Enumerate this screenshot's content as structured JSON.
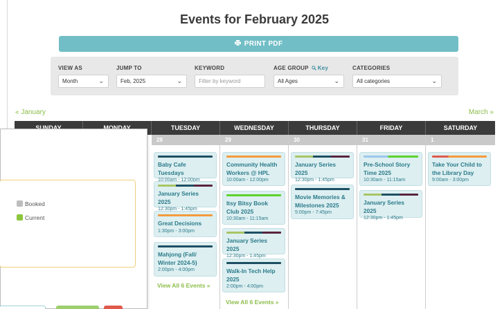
{
  "page": {
    "title": "Events for February 2025"
  },
  "print_button": {
    "label": "PRINT PDF",
    "icon": "printer-icon"
  },
  "filters": {
    "view_as": {
      "label": "VIEW AS",
      "value": "Month"
    },
    "jump_to": {
      "label": "JUMP TO",
      "value": "Feb, 2025"
    },
    "keyword": {
      "label": "KEYWORD",
      "placeholder": "Filter by keyword"
    },
    "age_group": {
      "label": "AGE GROUP",
      "key_label": "Key",
      "value": "All Ages"
    },
    "categories": {
      "label": "CATEGORIES",
      "value": "All categories"
    }
  },
  "nav": {
    "prev": "« January",
    "next": "March »"
  },
  "weekdays": [
    "SUNDAY",
    "MONDAY",
    "TUESDAY",
    "WEDNESDAY",
    "THURSDAY",
    "FRIDAY",
    "SATURDAY"
  ],
  "days": {
    "tuesday": {
      "date": "28",
      "events": [
        {
          "title": "Baby Cafe Tuesdays",
          "time": "10:00am - 12:00pm"
        },
        {
          "title": "January Series 2025",
          "time": "12:30pm - 1:45pm"
        },
        {
          "title": "Great Decisions",
          "time": "1:30pm - 3:00pm"
        },
        {
          "title": "Mahjong (Fall/ Winter 2024-5)",
          "time": "2:00pm - 4:00pm"
        }
      ],
      "view_all": "View All 6 Events »"
    },
    "wednesday": {
      "date": "29",
      "events": [
        {
          "title": "Community Health Workers @ HPL",
          "time": "10:00am - 12:00pm"
        },
        {
          "title": "Itsy Bitsy Book Club 2025",
          "time": "10:30am - 11:15am"
        },
        {
          "title": "January Series 2025",
          "time": "12:30pm - 1:45pm"
        },
        {
          "title": "Walk-In Tech Help 2025",
          "time": "2:00pm - 4:00pm"
        }
      ],
      "view_all": "View All 6 Events »"
    },
    "thursday": {
      "date": "30",
      "events": [
        {
          "title": "January Series 2025",
          "time": "12:30pm - 1:45pm"
        },
        {
          "title": "Movie Memories & Milestones 2025",
          "time": "5:00pm - 7:45pm"
        }
      ]
    },
    "friday": {
      "date": "31",
      "events": [
        {
          "title": "Pre-School Story Time 2025",
          "time": "10:30am - 11:15am"
        },
        {
          "title": "January Series 2025",
          "time": "12:30pm - 1:45pm"
        }
      ]
    },
    "saturday": {
      "date": "1",
      "events": [
        {
          "title": "Take Your Child to the Library Day",
          "time": "9:00am - 3:00pm"
        }
      ]
    }
  },
  "legend": {
    "booked": {
      "label": "Booked",
      "color": "#bdbdbd"
    },
    "current": {
      "label": "Current",
      "color": "#8cc63f"
    }
  },
  "colors": {
    "accent": "#71bec6",
    "link_green": "#8cbd4a",
    "event_text": "#2b7b8a",
    "header_dark": "#3b3b3b"
  }
}
